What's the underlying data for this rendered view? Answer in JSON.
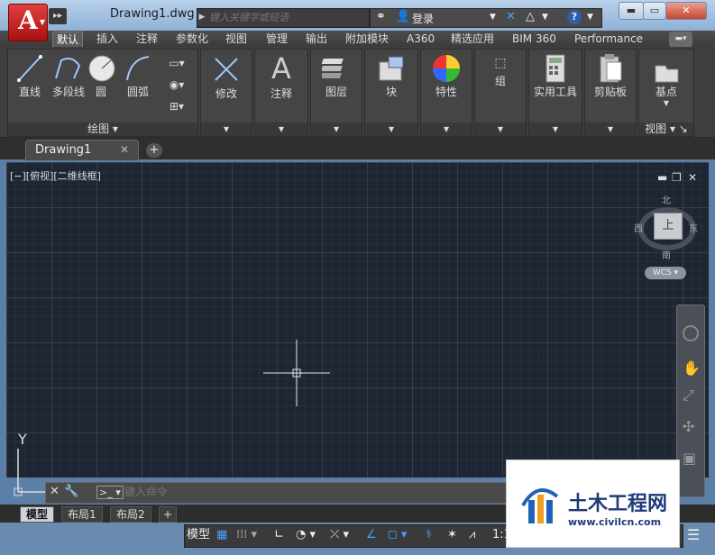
{
  "app": {
    "logo_letter": "A",
    "document_title": "Drawing1.dwg"
  },
  "search": {
    "placeholder": "键入关键字或短语"
  },
  "account": {
    "login_label": "登录"
  },
  "ribbon_tabs": [
    "默认",
    "插入",
    "注释",
    "参数化",
    "视图",
    "管理",
    "输出",
    "附加模块",
    "A360",
    "精选应用",
    "BIM 360",
    "Performance"
  ],
  "draw_panel": {
    "title": "绘图",
    "line": "直线",
    "polyline": "多段线",
    "circle": "圆",
    "arc": "圆弧"
  },
  "panels": {
    "modify": "修改",
    "annotate": "注释",
    "layers": "图层",
    "block": "块",
    "properties": "特性",
    "group": "组",
    "utilities": "实用工具",
    "clipboard": "剪贴板",
    "base": "基点",
    "view": "视图"
  },
  "file_tab": {
    "name": "Drawing1",
    "new_tab": "+"
  },
  "viewport": {
    "label": "[−][俯视][二维线框]"
  },
  "viewcube": {
    "north": "北",
    "south": "南",
    "east": "东",
    "west": "西",
    "top": "上",
    "wcs": "WCS"
  },
  "ucs": {
    "y_label": "Y"
  },
  "command": {
    "placeholder": "键入命令"
  },
  "layout_tabs": [
    "模型",
    "布局1",
    "布局2"
  ],
  "layout_add": "+",
  "status": {
    "model": "模型",
    "scale": "1:1"
  },
  "watermark": {
    "text": "土木工程网",
    "url": "www.civilcn.com"
  },
  "colors": {
    "viewport_bg": "#1f2633",
    "ribbon_bg": "#3f3f3f",
    "accent_red": "#c41e1e",
    "titlebar": "#a9c4e3"
  }
}
